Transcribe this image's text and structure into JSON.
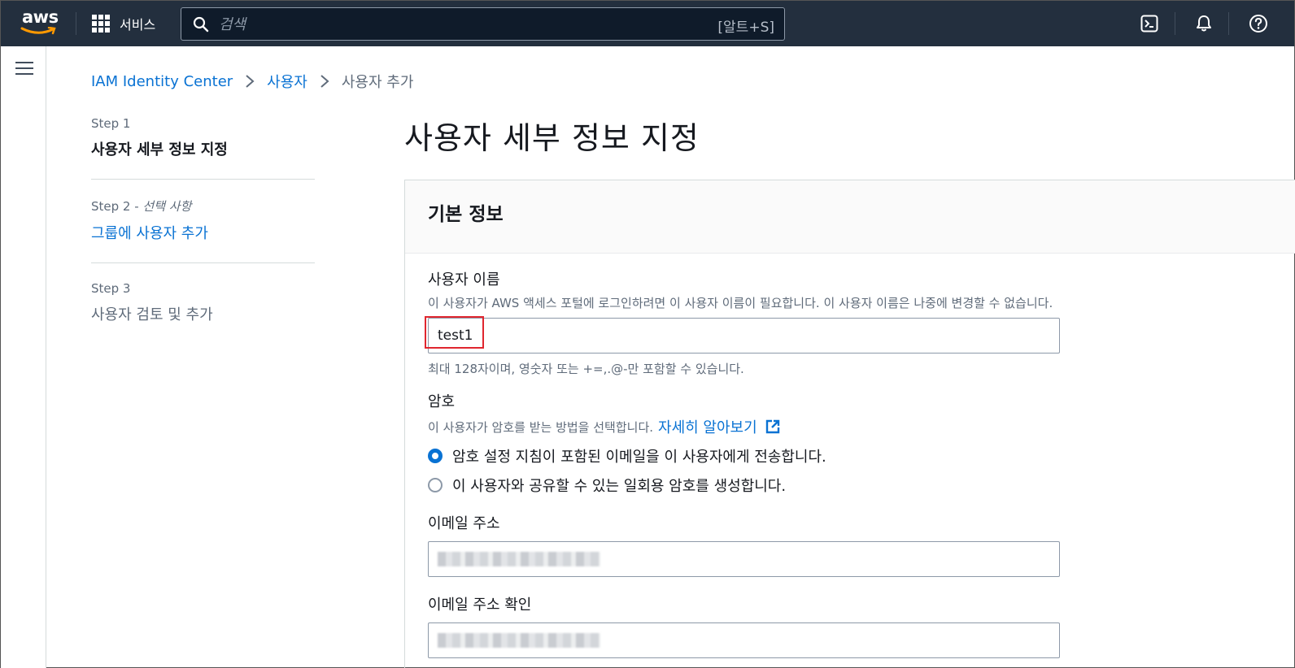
{
  "topnav": {
    "logo_text": "aws",
    "services_label": "서비스",
    "search_placeholder": "검색",
    "search_shortcut": "[알트+S]"
  },
  "breadcrumb": {
    "items": [
      "IAM Identity Center",
      "사용자"
    ],
    "current": "사용자 추가"
  },
  "steps": [
    {
      "num": "Step 1",
      "optional": "",
      "title": "사용자 세부 정보 지정"
    },
    {
      "num": "Step 2 - ",
      "optional": "선택 사항",
      "title": "그룹에 사용자 추가"
    },
    {
      "num": "Step 3",
      "optional": "",
      "title": "사용자 검토 및 추가"
    }
  ],
  "page_title": "사용자 세부 정보 지정",
  "section": {
    "title": "기본 정보",
    "username": {
      "label": "사용자 이름",
      "description": "이 사용자가 AWS 액세스 포털에 로그인하려면 이 사용자 이름이 필요합니다. 이 사용자 이름은 나중에 변경할 수 없습니다.",
      "value": "test1",
      "hint": "최대 128자이며, 영숫자 또는 +=,.@-만 포함할 수 있습니다."
    },
    "password": {
      "label": "암호",
      "description": "이 사용자가 암호를 받는 방법을 선택합니다.",
      "learn_more": "자세히 알아보기",
      "options": [
        {
          "label": "암호 설정 지침이 포함된 이메일을 이 사용자에게 전송합니다.",
          "checked": true
        },
        {
          "label": "이 사용자와 공유할 수 있는 일회용 암호를 생성합니다.",
          "checked": false
        }
      ]
    },
    "email": {
      "label": "이메일 주소"
    },
    "email_confirm": {
      "label": "이메일 주소 확인"
    }
  },
  "colors": {
    "nav_bg": "#232f3e",
    "link": "#0972d3",
    "highlight": "#e0262f"
  }
}
